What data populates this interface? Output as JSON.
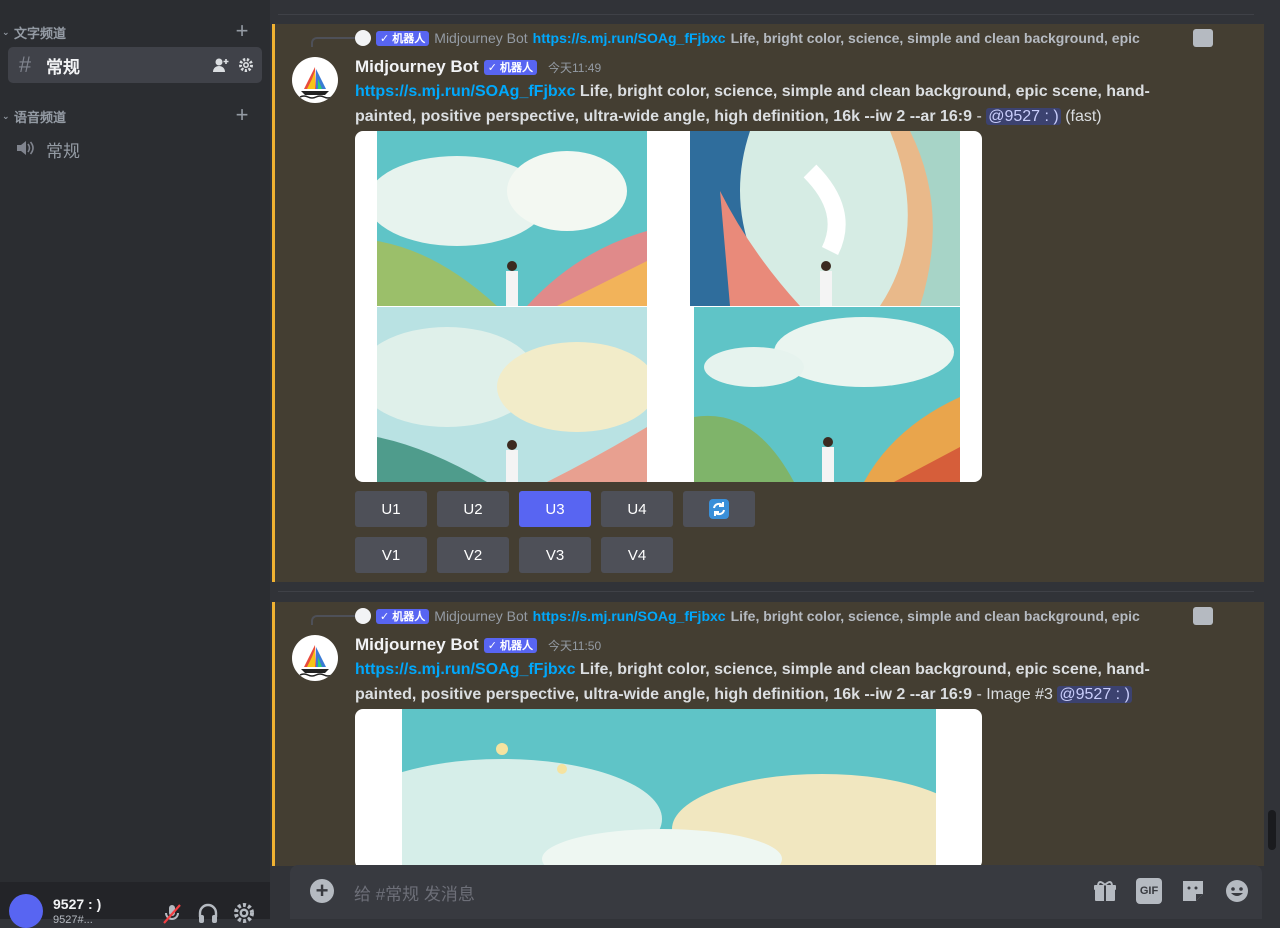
{
  "sidebar": {
    "text_category": "文字频道",
    "voice_category": "语音频道",
    "text_channel": "常规",
    "voice_channel": "常规"
  },
  "user": {
    "name": "9527 : )",
    "sub": "9527#..."
  },
  "messages": [
    {
      "reply_name": "Midjourney Bot",
      "reply_badge": "✓ 机器人",
      "reply_link": "https://s.mj.run/SOAg_fFjbxc",
      "reply_text": "Life, bright color, science, simple and clean background, epic",
      "author": "Midjourney Bot",
      "badge": "✓ 机器人",
      "timestamp": "今天11:49",
      "link": "https://s.mj.run/SOAg_fFjbxc",
      "prompt": "Life, bright color, science, simple and clean background, epic scene, hand-painted, positive perspective, ultra-wide angle, high definition, 16k --iw 2 --ar 16:9",
      "dash": " - ",
      "mention": "@9527 : )",
      "suffix": "(fast)",
      "buttons_row1": [
        "U1",
        "U2",
        "U3",
        "U4"
      ],
      "buttons_row2": [
        "V1",
        "V2",
        "V3",
        "V4"
      ]
    },
    {
      "reply_name": "Midjourney Bot",
      "reply_badge": "✓ 机器人",
      "reply_link": "https://s.mj.run/SOAg_fFjbxc",
      "reply_text": "Life, bright color, science, simple and clean background, epic",
      "author": "Midjourney Bot",
      "badge": "✓ 机器人",
      "timestamp": "今天11:50",
      "link": "https://s.mj.run/SOAg_fFjbxc",
      "prompt": "Life, bright color, science, simple and clean background, epic scene, hand-painted, positive perspective, ultra-wide angle, high definition, 16k --iw 2 --ar 16:9",
      "dash": " - Image #3 ",
      "mention": "@9527 : )"
    }
  ],
  "input": {
    "placeholder": "给 #常规 发消息",
    "gif_label": "GIF"
  },
  "colors": {
    "accent": "#5865f2",
    "link": "#00a8fc",
    "highlight_border": "#f0b232",
    "highlight_bg": "#443e32"
  }
}
